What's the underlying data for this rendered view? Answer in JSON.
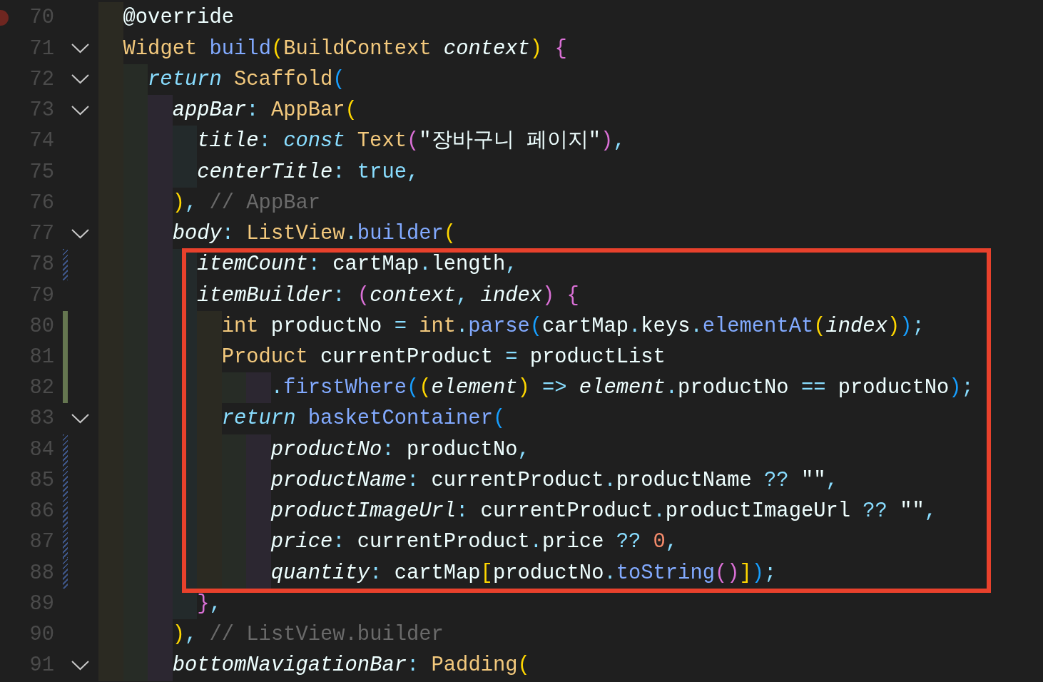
{
  "editor": {
    "lines_before": [
      {
        "number": "70",
        "breakpoint": true,
        "foldable": false,
        "tokens": [
          {
            "text": "  @override",
            "kind": "p"
          }
        ]
      },
      {
        "number": "71",
        "breakpoint": false,
        "foldable": true,
        "tokens": [
          {
            "text": "  Widget",
            "kind": "t"
          },
          {
            "text": " build",
            "kind": "f"
          },
          {
            "text": "(",
            "kind": "y"
          },
          {
            "text": "BuildContext",
            "kind": "t"
          },
          {
            "text": " context",
            "kind": "i"
          },
          {
            "text": ")",
            "kind": "y"
          },
          {
            "text": " {",
            "kind": "m"
          }
        ]
      },
      {
        "number": "72",
        "breakpoint": false,
        "foldable": true,
        "tokens": [
          {
            "text": "    return",
            "kind": "k"
          },
          {
            "text": " Scaffold",
            "kind": "t"
          },
          {
            "text": "(",
            "kind": "b"
          }
        ]
      },
      {
        "number": "73",
        "breakpoint": false,
        "foldable": true,
        "tokens": [
          {
            "text": "      appBar",
            "kind": "i"
          },
          {
            "text": ":",
            "kind": "o"
          },
          {
            "text": " AppBar",
            "kind": "t"
          },
          {
            "text": "(",
            "kind": "y"
          }
        ]
      },
      {
        "number": "74",
        "breakpoint": false,
        "foldable": false,
        "tokens": [
          {
            "text": "        title",
            "kind": "i"
          },
          {
            "text": ":",
            "kind": "o"
          },
          {
            "text": " const",
            "kind": "k"
          },
          {
            "text": " Text",
            "kind": "t"
          },
          {
            "text": "(",
            "kind": "m"
          },
          {
            "text": "\"장바구니 페이지\"",
            "kind": "s"
          },
          {
            "text": ")",
            "kind": "m"
          },
          {
            "text": ",",
            "kind": "o"
          }
        ]
      },
      {
        "number": "75",
        "breakpoint": false,
        "foldable": false,
        "tokens": [
          {
            "text": "        centerTitle",
            "kind": "i"
          },
          {
            "text": ":",
            "kind": "o"
          },
          {
            "text": " true",
            "kind": "c"
          },
          {
            "text": ",",
            "kind": "o"
          }
        ]
      },
      {
        "number": "76",
        "breakpoint": false,
        "foldable": false,
        "tokens": [
          {
            "text": "      )",
            "kind": "y"
          },
          {
            "text": ",",
            "kind": "o"
          },
          {
            "text": " // AppBar",
            "kind": "g"
          }
        ]
      },
      {
        "number": "77",
        "breakpoint": false,
        "foldable": true,
        "tokens": [
          {
            "text": "      body",
            "kind": "i"
          },
          {
            "text": ":",
            "kind": "o"
          },
          {
            "text": " ListView",
            "kind": "t"
          },
          {
            "text": ".",
            "kind": "o"
          },
          {
            "text": "builder",
            "kind": "f"
          },
          {
            "text": "(",
            "kind": "y"
          }
        ]
      }
    ],
    "highlighted_lines": [
      {
        "number": "78",
        "breakpoint": false,
        "foldable": false,
        "kind": "modified",
        "tokens": [
          {
            "text": "        itemCount",
            "kind": "i"
          },
          {
            "text": ":",
            "kind": "o"
          },
          {
            "text": " cartMap",
            "kind": "p"
          },
          {
            "text": ".",
            "kind": "o"
          },
          {
            "text": "length",
            "kind": "p"
          },
          {
            "text": ",",
            "kind": "o"
          }
        ]
      },
      {
        "number": "79",
        "breakpoint": false,
        "foldable": false,
        "tokens": [
          {
            "text": "        itemBuilder",
            "kind": "i"
          },
          {
            "text": ":",
            "kind": "o"
          },
          {
            "text": " (",
            "kind": "m"
          },
          {
            "text": "context",
            "kind": "i"
          },
          {
            "text": ",",
            "kind": "o"
          },
          {
            "text": " index",
            "kind": "i"
          },
          {
            "text": ")",
            "kind": "m"
          },
          {
            "text": " {",
            "kind": "m"
          }
        ]
      },
      {
        "number": "80",
        "breakpoint": false,
        "foldable": false,
        "kind": "added",
        "tokens": [
          {
            "text": "          int",
            "kind": "t"
          },
          {
            "text": " productNo ",
            "kind": "p"
          },
          {
            "text": "=",
            "kind": "o"
          },
          {
            "text": " int",
            "kind": "t"
          },
          {
            "text": ".",
            "kind": "o"
          },
          {
            "text": "parse",
            "kind": "f"
          },
          {
            "text": "(",
            "kind": "b"
          },
          {
            "text": "cartMap",
            "kind": "p"
          },
          {
            "text": ".",
            "kind": "o"
          },
          {
            "text": "keys",
            "kind": "p"
          },
          {
            "text": ".",
            "kind": "o"
          },
          {
            "text": "elementAt",
            "kind": "f"
          },
          {
            "text": "(",
            "kind": "y"
          },
          {
            "text": "index",
            "kind": "i"
          },
          {
            "text": ")",
            "kind": "y"
          },
          {
            "text": ")",
            "kind": "b"
          },
          {
            "text": ";",
            "kind": "o"
          }
        ]
      },
      {
        "number": "81",
        "breakpoint": false,
        "foldable": false,
        "kind": "added",
        "tokens": [
          {
            "text": "          Product",
            "kind": "t"
          },
          {
            "text": " currentProduct ",
            "kind": "p"
          },
          {
            "text": "=",
            "kind": "o"
          },
          {
            "text": " productList",
            "kind": "p"
          }
        ]
      },
      {
        "number": "82",
        "breakpoint": false,
        "foldable": false,
        "kind": "added",
        "tokens": [
          {
            "text": "              .",
            "kind": "o"
          },
          {
            "text": "firstWhere",
            "kind": "f"
          },
          {
            "text": "(",
            "kind": "b"
          },
          {
            "text": "(",
            "kind": "y"
          },
          {
            "text": "element",
            "kind": "i"
          },
          {
            "text": ")",
            "kind": "y"
          },
          {
            "text": " =>",
            "kind": "o"
          },
          {
            "text": " element",
            "kind": "i"
          },
          {
            "text": ".",
            "kind": "o"
          },
          {
            "text": "productNo ",
            "kind": "p"
          },
          {
            "text": "==",
            "kind": "o"
          },
          {
            "text": " productNo",
            "kind": "p"
          },
          {
            "text": ")",
            "kind": "b"
          },
          {
            "text": ";",
            "kind": "o"
          }
        ]
      },
      {
        "number": "83",
        "breakpoint": false,
        "foldable": true,
        "tokens": [
          {
            "text": "          return",
            "kind": "k"
          },
          {
            "text": " basketContainer",
            "kind": "f"
          },
          {
            "text": "(",
            "kind": "b"
          }
        ]
      },
      {
        "number": "84",
        "breakpoint": false,
        "foldable": false,
        "kind": "modified",
        "tokens": [
          {
            "text": "              productNo",
            "kind": "i"
          },
          {
            "text": ":",
            "kind": "o"
          },
          {
            "text": " productNo",
            "kind": "p"
          },
          {
            "text": ",",
            "kind": "o"
          }
        ]
      },
      {
        "number": "85",
        "breakpoint": false,
        "foldable": false,
        "kind": "modified",
        "tokens": [
          {
            "text": "              productName",
            "kind": "i"
          },
          {
            "text": ":",
            "kind": "o"
          },
          {
            "text": " currentProduct",
            "kind": "p"
          },
          {
            "text": ".",
            "kind": "o"
          },
          {
            "text": "productName ",
            "kind": "p"
          },
          {
            "text": "??",
            "kind": "o"
          },
          {
            "text": " \"\"",
            "kind": "p"
          },
          {
            "text": ",",
            "kind": "o"
          }
        ]
      },
      {
        "number": "86",
        "breakpoint": false,
        "foldable": false,
        "kind": "modified",
        "tokens": [
          {
            "text": "              productImageUrl",
            "kind": "i"
          },
          {
            "text": ":",
            "kind": "o"
          },
          {
            "text": " currentProduct",
            "kind": "p"
          },
          {
            "text": ".",
            "kind": "o"
          },
          {
            "text": "productImageUrl ",
            "kind": "p"
          },
          {
            "text": "??",
            "kind": "o"
          },
          {
            "text": " \"\"",
            "kind": "p"
          },
          {
            "text": ",",
            "kind": "o"
          }
        ]
      },
      {
        "number": "87",
        "breakpoint": false,
        "foldable": false,
        "kind": "modified",
        "tokens": [
          {
            "text": "              price",
            "kind": "i"
          },
          {
            "text": ":",
            "kind": "o"
          },
          {
            "text": " currentProduct",
            "kind": "p"
          },
          {
            "text": ".",
            "kind": "o"
          },
          {
            "text": "price ",
            "kind": "p"
          },
          {
            "text": "??",
            "kind": "o"
          },
          {
            "text": " 0",
            "kind": "n"
          },
          {
            "text": ",",
            "kind": "o"
          }
        ]
      },
      {
        "number": "88",
        "breakpoint": false,
        "foldable": false,
        "kind": "modified",
        "tokens": [
          {
            "text": "              quantity",
            "kind": "i"
          },
          {
            "text": ":",
            "kind": "o"
          },
          {
            "text": " cartMap",
            "kind": "p"
          },
          {
            "text": "[",
            "kind": "y"
          },
          {
            "text": "productNo",
            "kind": "p"
          },
          {
            "text": ".",
            "kind": "o"
          },
          {
            "text": "toString",
            "kind": "f"
          },
          {
            "text": "(",
            "kind": "m"
          },
          {
            "text": ")",
            "kind": "m"
          },
          {
            "text": "]",
            "kind": "y"
          },
          {
            "text": ")",
            "kind": "b"
          },
          {
            "text": ";",
            "kind": "o"
          }
        ]
      }
    ],
    "lines_after": [
      {
        "number": "89",
        "breakpoint": false,
        "foldable": false,
        "tokens": [
          {
            "text": "        }",
            "kind": "m"
          },
          {
            "text": ",",
            "kind": "o"
          }
        ]
      },
      {
        "number": "90",
        "breakpoint": false,
        "foldable": false,
        "tokens": [
          {
            "text": "      )",
            "kind": "y"
          },
          {
            "text": ",",
            "kind": "o"
          },
          {
            "text": " // ListView.builder",
            "kind": "g"
          }
        ]
      },
      {
        "number": "91",
        "breakpoint": false,
        "foldable": true,
        "tokens": [
          {
            "text": "      bottomNavigationBar",
            "kind": "i"
          },
          {
            "text": ":",
            "kind": "o"
          },
          {
            "text": " Padding",
            "kind": "t"
          },
          {
            "text": "(",
            "kind": "y"
          }
        ]
      }
    ]
  }
}
